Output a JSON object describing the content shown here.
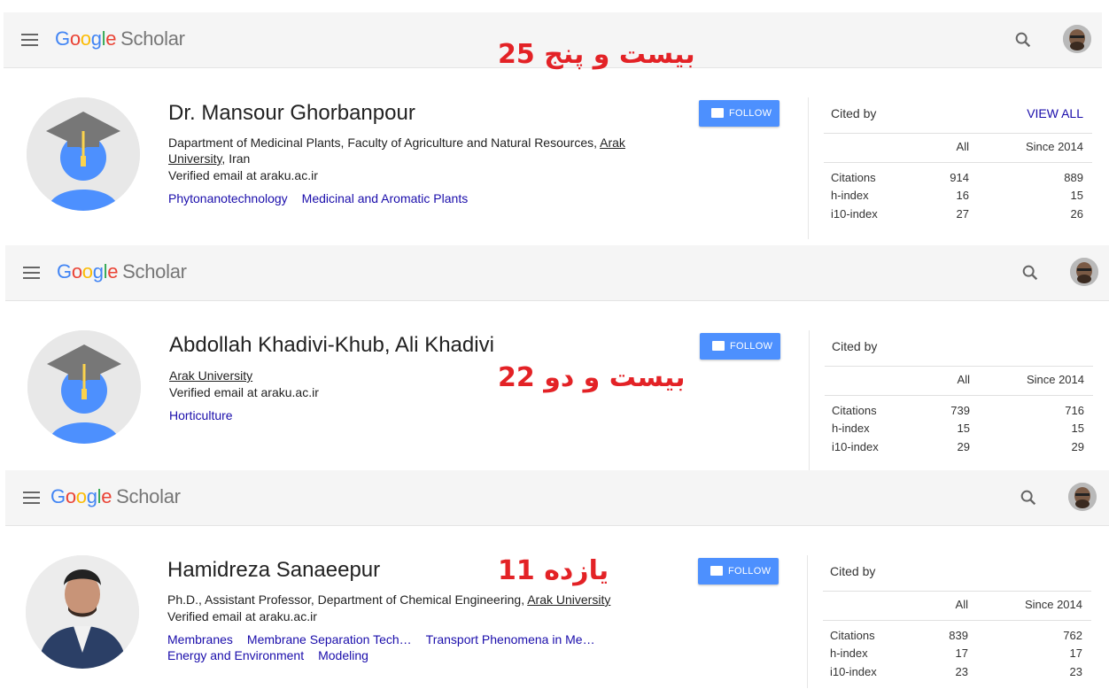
{
  "logo": {
    "g": "G",
    "o1": "o",
    "o2": "o",
    "g2": "g",
    "l": "l",
    "e": "e",
    "scholar": "Scholar"
  },
  "panels": [
    {
      "overlay": "بیست و پنج 25",
      "name": "Dr. Mansour Ghorbanpour",
      "affiliation_pre": "Dapartment of Medicinal Plants, Faculty of Agriculture and Natural Resources, ",
      "affiliation_link": "Arak University",
      "affiliation_post": ", Iran",
      "email": "Verified email at araku.ac.ir",
      "interests": [
        "Phytonanotechnology",
        "Medicinal and Aromatic Plants"
      ],
      "follow": "FOLLOW",
      "cited_by": "Cited by",
      "view_all": "VIEW ALL",
      "col_all": "All",
      "col_since": "Since 2014",
      "rows": [
        {
          "label": "Citations",
          "all": "914",
          "since": "889"
        },
        {
          "label": "h-index",
          "all": "16",
          "since": "15"
        },
        {
          "label": "i10-index",
          "all": "27",
          "since": "26"
        }
      ]
    },
    {
      "overlay": "بیست و دو 22",
      "name": "Abdollah Khadivi-Khub, Ali Khadivi",
      "affiliation_pre": "",
      "affiliation_link": "Arak University",
      "affiliation_post": "",
      "email": "Verified email at araku.ac.ir",
      "interests": [
        "Horticulture"
      ],
      "follow": "FOLLOW",
      "cited_by": "Cited by",
      "view_all": "",
      "col_all": "All",
      "col_since": "Since 2014",
      "rows": [
        {
          "label": "Citations",
          "all": "739",
          "since": "716"
        },
        {
          "label": "h-index",
          "all": "15",
          "since": "15"
        },
        {
          "label": "i10-index",
          "all": "29",
          "since": "29"
        }
      ]
    },
    {
      "overlay": "یازده 11",
      "name": "Hamidreza Sanaeepur",
      "affiliation_pre": "Ph.D., Assistant Professor, Department of Chemical Engineering, ",
      "affiliation_link": "Arak University",
      "affiliation_post": "",
      "email": "Verified email at araku.ac.ir",
      "interests": [
        "Membranes",
        "Membrane Separation Tech…",
        "Transport Phenomena in Me…",
        "Energy and Environment",
        "Modeling"
      ],
      "follow": "FOLLOW",
      "cited_by": "Cited by",
      "view_all": "",
      "col_all": "All",
      "col_since": "Since 2014",
      "rows": [
        {
          "label": "Citations",
          "all": "839",
          "since": "762"
        },
        {
          "label": "h-index",
          "all": "17",
          "since": "17"
        },
        {
          "label": "i10-index",
          "all": "23",
          "since": "23"
        }
      ]
    }
  ]
}
